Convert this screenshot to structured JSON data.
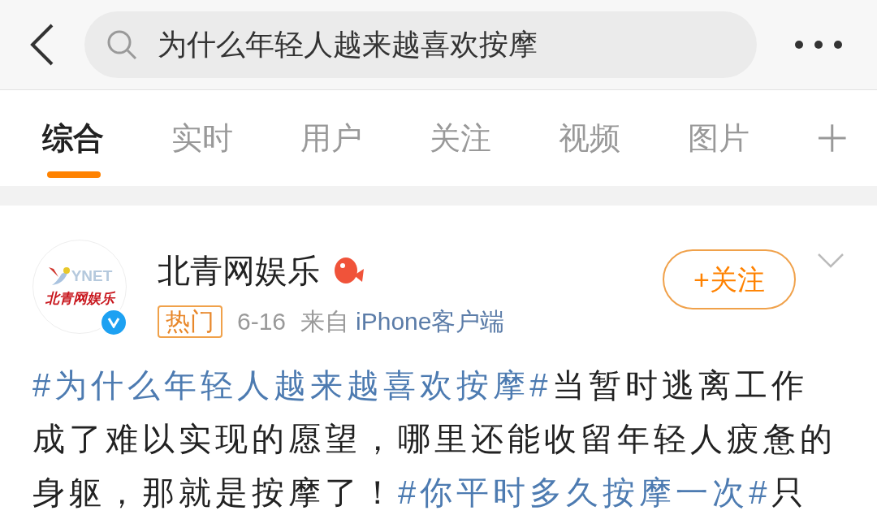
{
  "search": {
    "query": "为什么年轻人越来越喜欢按摩"
  },
  "tabs": [
    {
      "label": "综合",
      "selected": true
    },
    {
      "label": "实时",
      "selected": false
    },
    {
      "label": "用户",
      "selected": false
    },
    {
      "label": "关注",
      "selected": false
    },
    {
      "label": "视频",
      "selected": false
    },
    {
      "label": "图片",
      "selected": false
    }
  ],
  "post": {
    "avatar_logo": {
      "mark": "YNET",
      "name": "北青网娱乐"
    },
    "verified": true,
    "author": "北青网娱乐",
    "badge": "热门",
    "date": "6-16",
    "source_prefix": "来自",
    "source": "iPhone客户端",
    "follow_button": "+关注",
    "lines": [
      [
        {
          "kind": "hashtag",
          "text": "#为什么年轻人越来越喜欢按摩#"
        },
        {
          "kind": "text",
          "text": "当暂时逃离工作"
        }
      ],
      [
        {
          "kind": "text",
          "text": "成了难以实现的愿望，哪里还能收留年轻人疲惫的"
        }
      ],
      [
        {
          "kind": "text",
          "text": "身躯，那就是按摩了！"
        },
        {
          "kind": "hashtag",
          "text": "#你平时多久按摩一次#"
        },
        {
          "kind": "text",
          "text": "只"
        }
      ]
    ]
  }
}
